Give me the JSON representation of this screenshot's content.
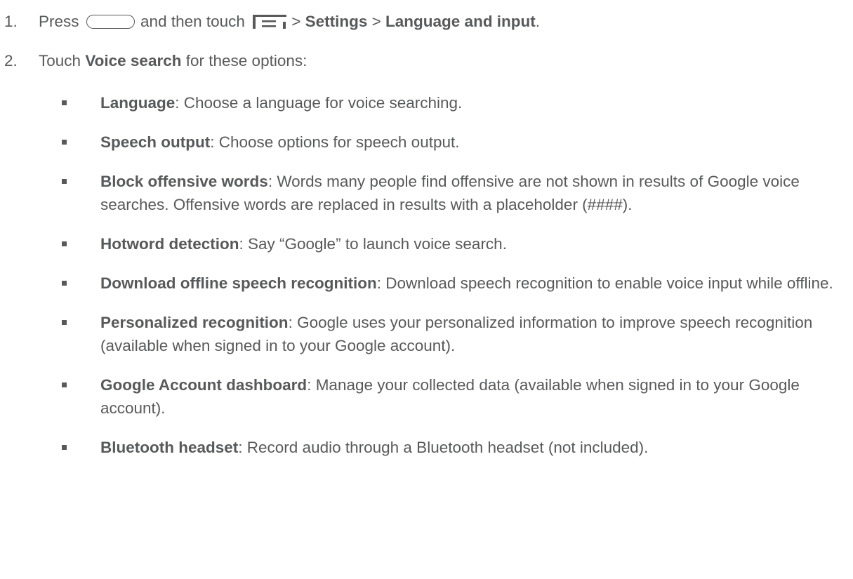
{
  "steps": [
    {
      "number": "1.",
      "press": "Press",
      "and_then": "and then touch",
      "sep1": ">",
      "settings": "Settings",
      "sep2": ">",
      "language_input": "Language and input",
      "end": "."
    },
    {
      "number": "2.",
      "touch": "Touch",
      "voice_search": "Voice search",
      "rest": "for these options:"
    }
  ],
  "icons": {
    "home_button": "home-button-icon",
    "menu": "menu-icon"
  },
  "options": [
    {
      "term": "Language",
      "desc": ": Choose a language for voice searching."
    },
    {
      "term": "Speech output",
      "desc": ": Choose options for speech output."
    },
    {
      "term": "Block offensive words",
      "desc": ": Words many people find offensive are not shown in results of Google voice searches. Offensive words are replaced in results with a placeholder (####)."
    },
    {
      "term": "Hotword detection",
      "desc": ": Say “Google” to launch voice search."
    },
    {
      "term": "Download offline speech recognition",
      "desc": ": Download speech recognition to enable voice input while offline."
    },
    {
      "term": "Personalized recognition",
      "desc": ": Google uses your personalized information to improve speech recognition (available when signed in to your Google account)."
    },
    {
      "term": "Google Account dashboard",
      "desc": ": Manage your collected data (available when signed in to your Google account)."
    },
    {
      "term": "Bluetooth headset",
      "desc": ": Record audio through a Bluetooth headset (not included)."
    }
  ]
}
